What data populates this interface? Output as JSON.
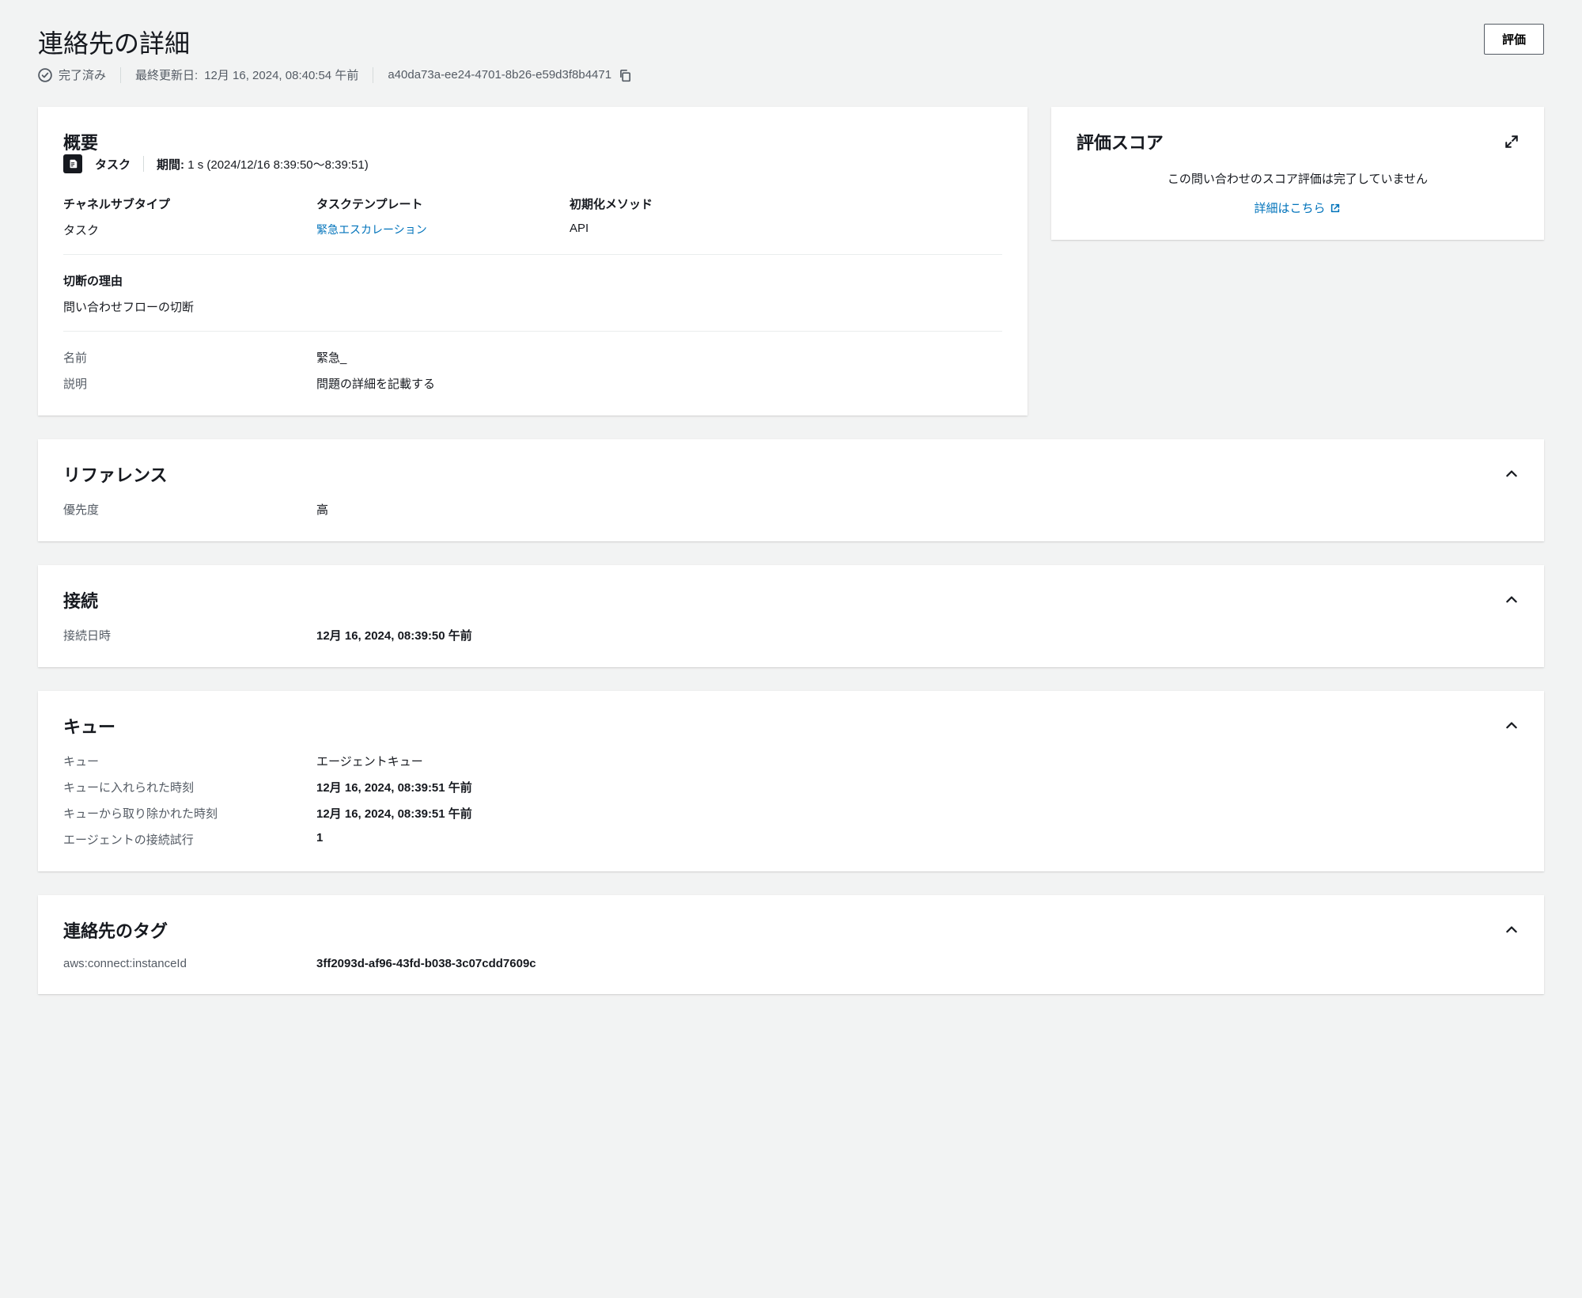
{
  "header": {
    "title": "連絡先の詳細",
    "evaluate_button": "評価"
  },
  "meta": {
    "status": "完了済み",
    "last_updated_label": "最終更新日:",
    "last_updated_value": "12月 16, 2024, 08:40:54 午前",
    "contact_id": "a40da73a-ee24-4701-8b26-e59d3f8b4471"
  },
  "overview": {
    "title": "概要",
    "task_label": "タスク",
    "duration_label": "期間:",
    "duration_value": "1 s (2024/12/16 8:39:50～8:39:51)",
    "channel_subtype_label": "チャネルサブタイプ",
    "channel_subtype_value": "タスク",
    "task_template_label": "タスクテンプレート",
    "task_template_value": "緊急エスカレーション",
    "init_method_label": "初期化メソッド",
    "init_method_value": "API",
    "disconnect_reason_label": "切断の理由",
    "disconnect_reason_value": "問い合わせフローの切断",
    "name_label": "名前",
    "name_value": "緊急_",
    "description_label": "説明",
    "description_value": "問題の詳細を記載する"
  },
  "score": {
    "title": "評価スコア",
    "message": "この問い合わせのスコア評価は完了していません",
    "details_link": "詳細はこちら"
  },
  "reference": {
    "title": "リファレンス",
    "priority_label": "優先度",
    "priority_value": "高"
  },
  "connection": {
    "title": "接続",
    "connected_at_label": "接続日時",
    "connected_at_value": "12月 16, 2024, 08:39:50 午前"
  },
  "queue": {
    "title": "キュー",
    "queue_label": "キュー",
    "queue_value": "エージェントキュー",
    "enqueue_time_label": "キューに入れられた時刻",
    "enqueue_time_value": "12月 16, 2024, 08:39:51 午前",
    "dequeue_time_label": "キューから取り除かれた時刻",
    "dequeue_time_value": "12月 16, 2024, 08:39:51 午前",
    "agent_attempts_label": "エージェントの接続試行",
    "agent_attempts_value": "1"
  },
  "tags": {
    "title": "連絡先のタグ",
    "tag_key": "aws:connect:instanceId",
    "tag_value": "3ff2093d-af96-43fd-b038-3c07cdd7609c"
  }
}
